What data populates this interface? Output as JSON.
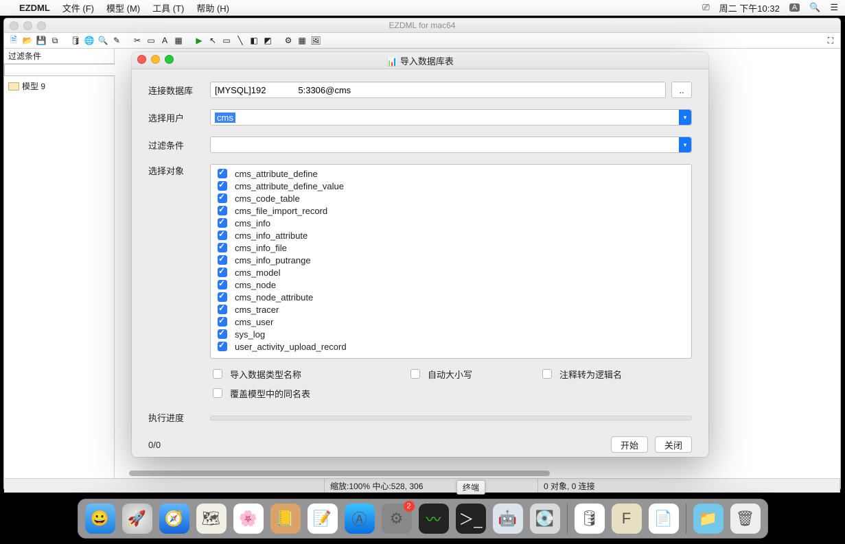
{
  "menubar": {
    "app": "EZDML",
    "items": [
      "文件 (F)",
      "模型 (M)",
      "工具 (T)",
      "帮助 (H)"
    ],
    "clock": "周二 下午10:32",
    "ime": "A"
  },
  "mainwin": {
    "title": "EZDML for mac64",
    "sidebar": {
      "filter_label": "过滤条件",
      "tree_item": "模型 9"
    },
    "status": {
      "zoom": "缩放:100% 中心:528, 306",
      "objects": "0 对象, 0 连接"
    }
  },
  "dialog": {
    "title": "导入数据库表",
    "rows": {
      "conn_label": "连接数据库",
      "conn_value": "[MYSQL]192             5:3306@cms",
      "conn_btn": "..",
      "user_label": "选择用户",
      "user_value": "cms",
      "filter_label": "过滤条件",
      "filter_value": "",
      "target_label": "选择对象",
      "progress_label": "执行进度"
    },
    "tables": [
      "cms_attribute_define",
      "cms_attribute_define_value",
      "cms_code_table",
      "cms_file_import_record",
      "cms_info",
      "cms_info_attribute",
      "cms_info_file",
      "cms_info_putrange",
      "cms_model",
      "cms_node",
      "cms_node_attribute",
      "cms_tracer",
      "cms_user",
      "sys_log",
      "user_activity_upload_record"
    ],
    "opts": {
      "import_typename": "导入数据类型名称",
      "auto_case": "自动大小写",
      "comment_logic": "注释转为逻辑名",
      "overwrite": "覆盖模型中的同名表"
    },
    "count": "0/0",
    "btn_start": "开始",
    "btn_close": "关闭"
  },
  "dock": {
    "tooltip": "终端",
    "apps": [
      "finder",
      "launchpad",
      "safari",
      "maps",
      "photos",
      "contacts",
      "notes",
      "appstore",
      "settings",
      "terminal-badge",
      "activity",
      "terminal",
      "automator",
      "diskutil"
    ],
    "apps_right": [
      "db",
      "font",
      "textedit"
    ],
    "apps_end": [
      "downloads",
      "trash"
    ]
  }
}
